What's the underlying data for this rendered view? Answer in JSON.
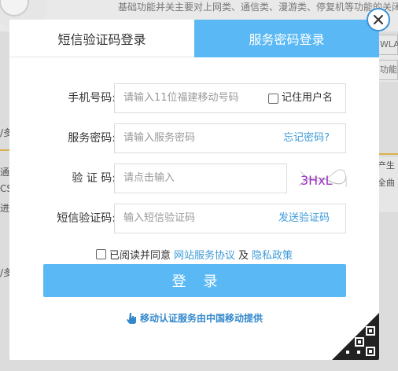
{
  "background": {
    "top_text": "基础功能并关主要对上网类、通信类、漫游类、停复机等功能的关闭",
    "right_tabs": [
      "WLA",
      "功能"
    ],
    "left_snippets": [
      "/多",
      "通",
      "CS",
      "进",
      "/多"
    ],
    "side_snippets": [
      "产生",
      "全曲"
    ]
  },
  "tabs": {
    "sms_login": "短信验证码登录",
    "password_login": "服务密码登录"
  },
  "form": {
    "phone_label": "手机号码:",
    "phone_placeholder": "请输入11位福建移动号码",
    "remember_label": "记住用户名",
    "password_label": "服务密码:",
    "password_placeholder": "请输入服务密码",
    "forgot_link": "忘记密码?",
    "captcha_label": "验 证 码:",
    "captcha_placeholder": "请点击输入",
    "captcha_text": "3HxL",
    "sms_label": "短信验证码:",
    "sms_placeholder": "输入短信验证码",
    "send_sms_link": "发送验证码"
  },
  "agreement": {
    "prefix": "已阅读并同意",
    "terms_link": "网站服务协议",
    "and": "及",
    "privacy_link": "隐私政策"
  },
  "login_button": "登录",
  "footer_note": "移动认证服务由中国移动提供",
  "colors": {
    "accent": "#5ab9f5",
    "link": "#3d9bd8",
    "close_border": "#3b93d6"
  },
  "icons": [
    "close-icon",
    "checkbox-icon",
    "hand-pointer-icon",
    "qr-code-icon"
  ]
}
